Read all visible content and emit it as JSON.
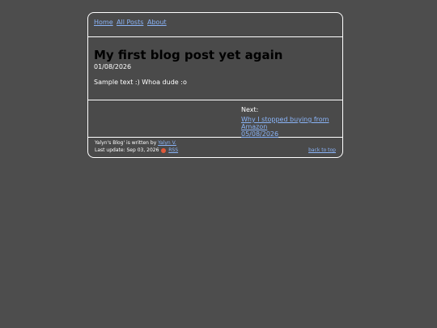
{
  "nav": {
    "home": "Home",
    "all_posts": "All Posts",
    "about": "About"
  },
  "post": {
    "title": "My first blog post yet again",
    "date": "01/08/2026",
    "body": "Sample text :) Whoa dude :o"
  },
  "next": {
    "label": "Next:",
    "link_title": "Why I stopped buying from Amazon",
    "link_date": "05/08/2026"
  },
  "footer": {
    "written_prefix": "Yalyn's Blog' is written by ",
    "author": "Yalyn V.",
    "update_prefix": "Last update: Sep 03, 2026",
    "rss": "RSS",
    "back_to_top": "back to top",
    "rss_icon": "rss-icon"
  },
  "colors": {
    "background": "#4d4d4d",
    "link": "#8ab4f8",
    "title": "#000000",
    "border": "#ffffff"
  }
}
